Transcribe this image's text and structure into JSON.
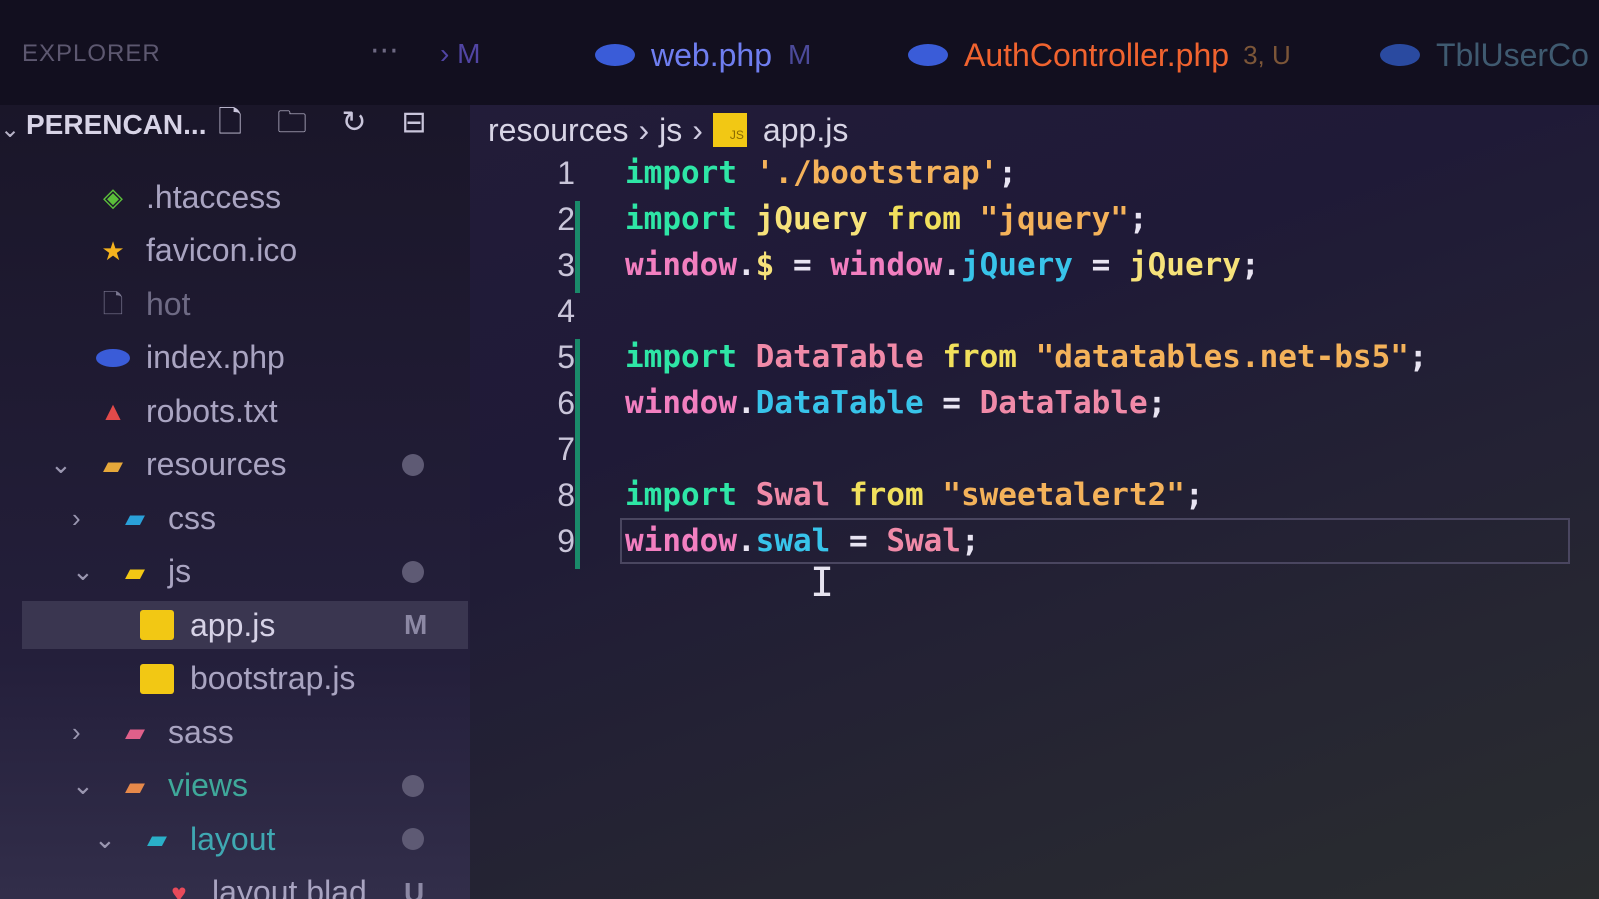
{
  "tabbar": {
    "explorer_title": "EXPLORER",
    "more_label": "···",
    "prev_tab_fragment": "› M",
    "tabs": [
      {
        "name": "web.php",
        "badge": "M",
        "active": false,
        "icon": "php-icon"
      },
      {
        "name": "AuthController.php",
        "badge": "3, U",
        "active": true,
        "icon": "php-icon"
      },
      {
        "name": "TblUserCo",
        "badge": "",
        "active": false,
        "icon": "php-icon"
      }
    ]
  },
  "sidebar": {
    "folder_name": "PERENCAN...",
    "header_icons": [
      "new-file-icon",
      "new-folder-icon",
      "refresh-icon",
      "collapse-all-icon"
    ],
    "items": [
      {
        "label": ".htaccess",
        "icon": "config-file-icon",
        "color": "#5bbf3a",
        "indent": 0,
        "status": ""
      },
      {
        "label": "favicon.ico",
        "icon": "star-icon",
        "color": "#f4b21e",
        "indent": 0,
        "status": ""
      },
      {
        "label": "hot",
        "icon": "file-icon",
        "color": "#7a7690",
        "indent": 0,
        "status": ""
      },
      {
        "label": "index.php",
        "icon": "php-icon",
        "color": "#3a5cd8",
        "indent": 0,
        "status": ""
      },
      {
        "label": "robots.txt",
        "icon": "robot-icon",
        "color": "#e24a4a",
        "indent": 0,
        "status": ""
      },
      {
        "label": "resources",
        "icon": "folder-open-icon",
        "color": "#e6a83a",
        "indent": 0,
        "status": "dot",
        "twisty": "open"
      },
      {
        "label": "css",
        "icon": "css-folder-icon",
        "color": "#2aa0d8",
        "indent": 1,
        "status": "",
        "twisty": "closed"
      },
      {
        "label": "js",
        "icon": "js-folder-icon",
        "color": "#f2c814",
        "indent": 1,
        "status": "dot",
        "twisty": "open"
      },
      {
        "label": "app.js",
        "icon": "js-file-icon",
        "color": "#f2c814",
        "indent": 2,
        "status": "M",
        "selected": true
      },
      {
        "label": "bootstrap.js",
        "icon": "js-file-icon",
        "color": "#f2c814",
        "indent": 2,
        "status": ""
      },
      {
        "label": "sass",
        "icon": "sass-folder-icon",
        "color": "#e0608a",
        "indent": 1,
        "status": "",
        "twisty": "closed"
      },
      {
        "label": "views",
        "icon": "views-folder-icon",
        "color": "#e6894a",
        "indent": 1,
        "status": "dot",
        "twisty": "open"
      },
      {
        "label": "layout",
        "icon": "layout-folder-icon",
        "color": "#2ab0c8",
        "indent": 2,
        "status": "dot",
        "twisty": "open"
      },
      {
        "label": "layout.blad...",
        "icon": "blade-file-icon",
        "color": "#e84a5a",
        "indent": 3,
        "status": "U"
      }
    ]
  },
  "breadcrumb": {
    "parts": [
      "resources",
      "js",
      "app.js"
    ]
  },
  "editor": {
    "current_line": 9,
    "lines": [
      {
        "n": "1",
        "tokens": [
          [
            "kw",
            "import"
          ],
          [
            "punc",
            " "
          ],
          [
            "str",
            "'./bootstrap'"
          ],
          [
            "punc",
            ";"
          ]
        ]
      },
      {
        "n": "2",
        "tokens": [
          [
            "kw",
            "import"
          ],
          [
            "punc",
            " "
          ],
          [
            "cls",
            "jQuery"
          ],
          [
            "punc",
            " "
          ],
          [
            "from",
            "from"
          ],
          [
            "punc",
            " "
          ],
          [
            "str",
            "\"jquery\""
          ],
          [
            "punc",
            ";"
          ]
        ]
      },
      {
        "n": "3",
        "tokens": [
          [
            "win",
            "window"
          ],
          [
            "punc",
            "."
          ],
          [
            "cls",
            "$"
          ],
          [
            "punc",
            " = "
          ],
          [
            "win",
            "window"
          ],
          [
            "punc",
            "."
          ],
          [
            "prop",
            "jQuery"
          ],
          [
            "punc",
            " = "
          ],
          [
            "cls",
            "jQuery"
          ],
          [
            "punc",
            ";"
          ]
        ]
      },
      {
        "n": "4",
        "tokens": []
      },
      {
        "n": "5",
        "tokens": [
          [
            "kw",
            "import"
          ],
          [
            "punc",
            " "
          ],
          [
            "id",
            "DataTable"
          ],
          [
            "punc",
            " "
          ],
          [
            "from",
            "from"
          ],
          [
            "punc",
            " "
          ],
          [
            "str",
            "\"datatables.net-bs5\""
          ],
          [
            "punc",
            ";"
          ]
        ]
      },
      {
        "n": "6",
        "tokens": [
          [
            "win",
            "window"
          ],
          [
            "punc",
            "."
          ],
          [
            "prop",
            "DataTable"
          ],
          [
            "punc",
            " = "
          ],
          [
            "id",
            "DataTable"
          ],
          [
            "punc",
            ";"
          ]
        ]
      },
      {
        "n": "7",
        "tokens": []
      },
      {
        "n": "8",
        "tokens": [
          [
            "kw",
            "import"
          ],
          [
            "punc",
            " "
          ],
          [
            "id",
            "Swal"
          ],
          [
            "punc",
            " "
          ],
          [
            "from",
            "from"
          ],
          [
            "punc",
            " "
          ],
          [
            "str",
            "\"sweetalert2\""
          ],
          [
            "punc",
            ";"
          ]
        ]
      },
      {
        "n": "9",
        "tokens": [
          [
            "win",
            "window"
          ],
          [
            "punc",
            "."
          ],
          [
            "prop",
            "swal"
          ],
          [
            "punc",
            " = "
          ],
          [
            "id",
            "Swal"
          ],
          [
            "punc",
            ";"
          ]
        ]
      }
    ]
  },
  "colors": {
    "keyword": "#2ee6a6",
    "string": "#f4b25a",
    "identifier": "#f08aa8",
    "property": "#38c4ea",
    "modified_gutter": "#1a8a6a"
  }
}
